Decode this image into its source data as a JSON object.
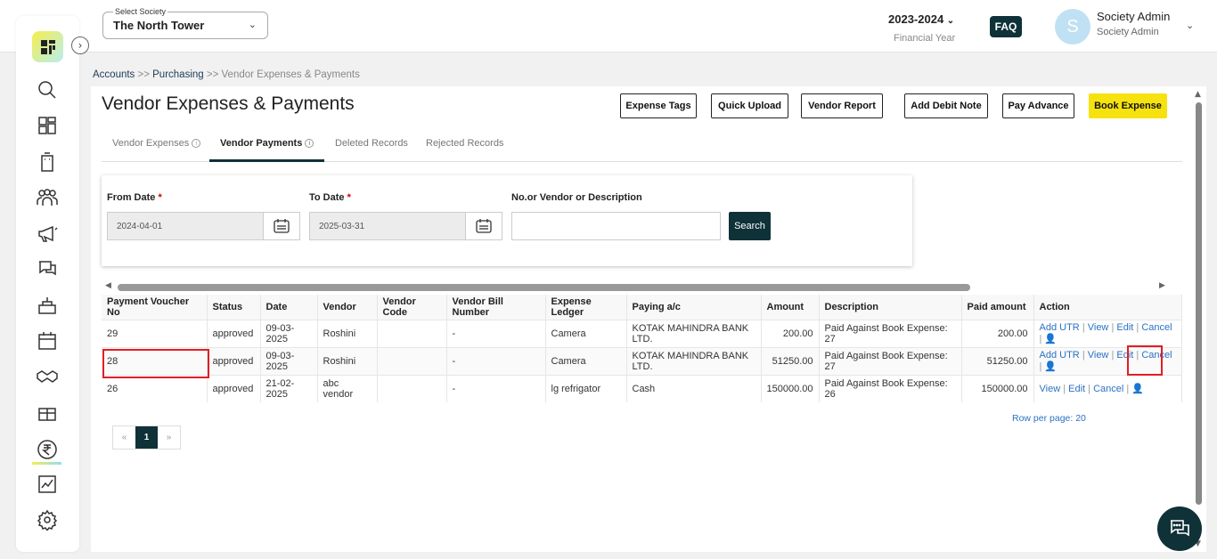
{
  "header": {
    "society_label": "Select Society",
    "society_value": "The North Tower",
    "financial_year": "2023-2024",
    "financial_year_label": "Financial Year",
    "faq": "FAQ",
    "avatar_letter": "S",
    "user_name": "Society Admin",
    "user_role": "Society Admin"
  },
  "breadcrumb": {
    "accounts": "Accounts",
    "sep1": " >> ",
    "purchasing": "Purchasing",
    "current": " >> Vendor Expenses & Payments"
  },
  "page": {
    "title": "Vendor Expenses & Payments",
    "buttons": {
      "expense_tags": "Expense Tags",
      "quick_upload": "Quick Upload",
      "vendor_report": "Vendor Report",
      "add_debit_note": "Add Debit Note",
      "pay_advance": "Pay Advance",
      "book_expense": "Book Expense"
    },
    "tabs": {
      "vendor_expenses": "Vendor Expenses",
      "vendor_payments": "Vendor Payments",
      "deleted_records": "Deleted Records",
      "rejected_records": "Rejected Records"
    }
  },
  "filter": {
    "from_label": "From Date",
    "from_value": "2024-04-01",
    "to_label": "To Date",
    "to_value": "2025-03-31",
    "search_label": "No.or Vendor or Description",
    "search_value": "",
    "search_button": "Search",
    "required_mark": "*"
  },
  "table": {
    "headers": {
      "voucher": "Payment Voucher No",
      "status": "Status",
      "date": "Date",
      "vendor": "Vendor",
      "vendor_code": "Vendor Code",
      "bill": "Vendor Bill Number",
      "ledger": "Expense Ledger",
      "paying": "Paying a/c",
      "amount": "Amount",
      "description": "Description",
      "paid": "Paid amount",
      "action": "Action"
    },
    "rows": [
      {
        "voucher": "29",
        "status": "approved",
        "date": "09-03-2025",
        "vendor": "Roshini",
        "vendor_code": "",
        "bill": "-",
        "ledger": "Camera",
        "paying": "KOTAK MAHINDRA BANK LTD.",
        "amount": "200.00",
        "description": "Paid Against Book Expense: 27",
        "paid": "200.00"
      },
      {
        "voucher": "28",
        "status": "approved",
        "date": "09-03-2025",
        "vendor": "Roshini",
        "vendor_code": "",
        "bill": "-",
        "ledger": "Camera",
        "paying": "KOTAK MAHINDRA BANK LTD.",
        "amount": "51250.00",
        "description": "Paid Against Book Expense: 27",
        "paid": "51250.00"
      },
      {
        "voucher": "26",
        "status": "approved",
        "date": "21-02-2025",
        "vendor": "abc vendor",
        "vendor_code": "",
        "bill": "-",
        "ledger": "lg refrigator",
        "paying": "Cash",
        "amount": "150000.00",
        "description": "Paid Against Book Expense: 26",
        "paid": "150000.00"
      }
    ],
    "actions": {
      "add_utr": "Add UTR",
      "view": "View",
      "edit": "Edit",
      "cancel": "Cancel",
      "sep": "|"
    }
  },
  "pagination": {
    "prev": "«",
    "current": "1",
    "next": "»",
    "rows_per_page": "Row per page: 20"
  },
  "colors": {
    "dark": "#0f3138",
    "accent_yellow": "#f6e20f",
    "link": "#2a72c4",
    "highlight": "#e11e24"
  }
}
